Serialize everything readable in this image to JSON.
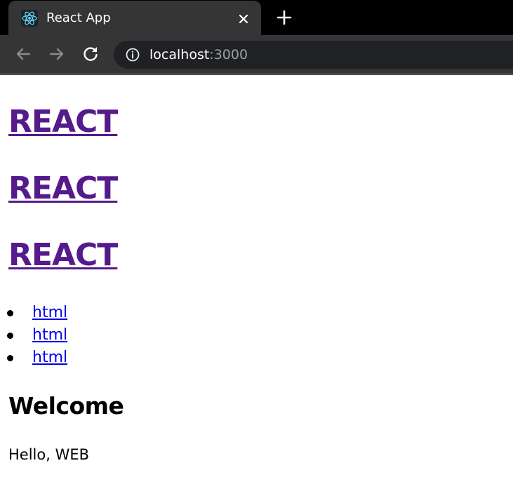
{
  "browser": {
    "tab_title": "React App",
    "url_host": "localhost",
    "url_port": ":3000",
    "colors": {
      "chrome_bg": "#000000",
      "tab_bg": "#353535",
      "omnibox_bg": "#202124",
      "react_logo": "#61dafb"
    }
  },
  "page": {
    "headings": [
      {
        "label": "REACT"
      },
      {
        "label": "REACT"
      },
      {
        "label": "REACT"
      }
    ],
    "nav_items": [
      {
        "label": "html"
      },
      {
        "label": "html"
      },
      {
        "label": "html"
      }
    ],
    "article": {
      "title": "Welcome",
      "body": "Hello, WEB"
    },
    "colors": {
      "visited_link": "#551a8b",
      "link": "#0000ee"
    }
  }
}
